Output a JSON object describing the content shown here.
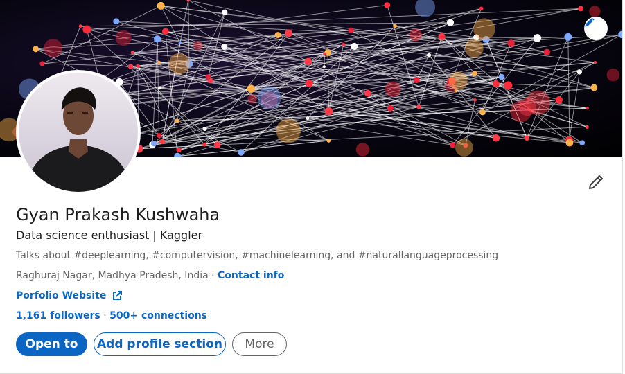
{
  "profile": {
    "name": "Gyan Prakash Kushwaha",
    "headline": "Data science enthusiast | Kaggler",
    "talks_about": "Talks about #deeplearning, #computervision, #machinelearning, and #naturallanguageprocessing",
    "location": "Raghuraj Nagar, Madhya Pradesh, India",
    "location_separator": " · ",
    "contact_info_label": "Contact info",
    "website_label": "Porfolio Website",
    "followers_label": "1,161 followers",
    "stats_separator": " · ",
    "connections_label": "500+ connections"
  },
  "actions": {
    "open_to_label": "Open to",
    "add_section_label": "Add profile section",
    "more_label": "More"
  },
  "icons": {
    "banner_edit": "pencil-icon",
    "intro_edit": "pencil-icon",
    "external_link": "external-link-icon"
  },
  "colors": {
    "brand_blue": "#0a66c2",
    "text_primary": "#1d1d1d",
    "text_secondary": "#666666"
  }
}
